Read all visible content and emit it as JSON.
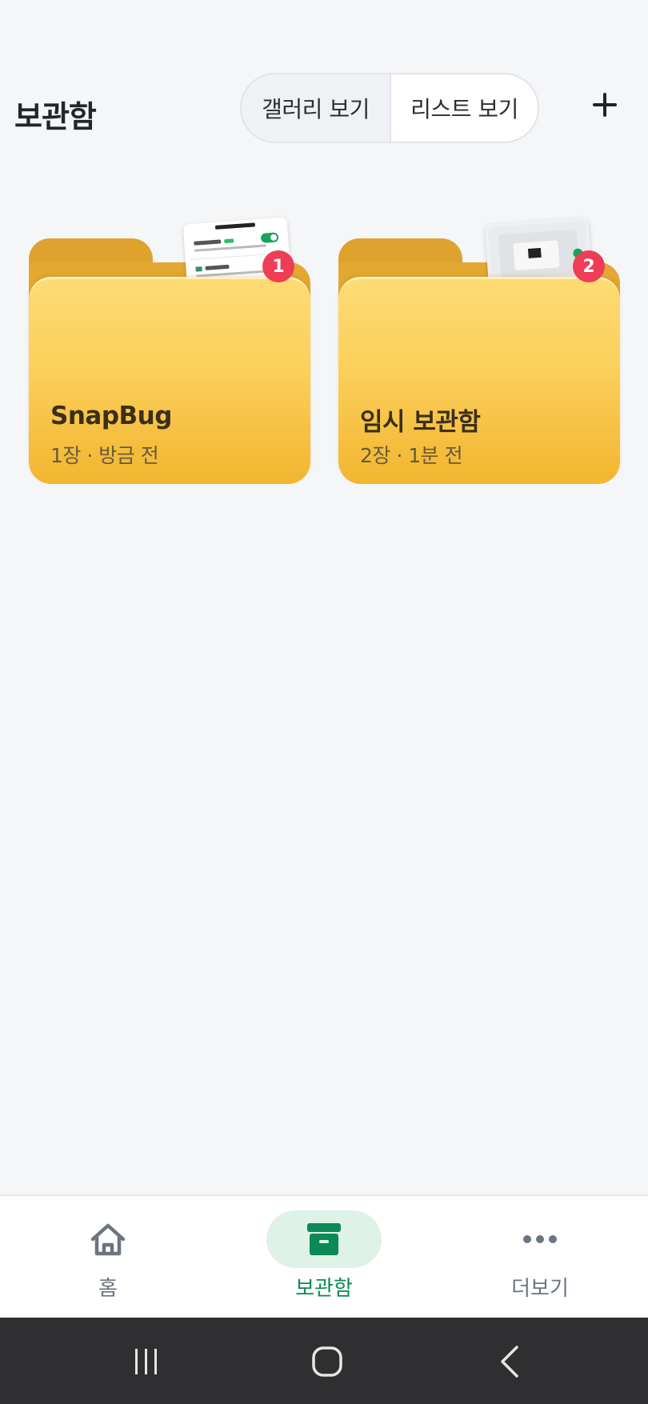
{
  "header": {
    "title": "보관함",
    "view_toggle": {
      "gallery_label": "갤러리 보기",
      "list_label": "리스트 보기",
      "selected": "리스트 보기"
    },
    "add_icon": "plus-icon"
  },
  "folders": [
    {
      "name": "SnapBug",
      "meta": "1장 · 방금 전",
      "badge": "1"
    },
    {
      "name": "임시 보관함",
      "meta": "2장 · 1분 전",
      "badge": "2"
    }
  ],
  "bottom_nav": {
    "items": [
      {
        "label": "홈",
        "icon": "home-icon",
        "active": false
      },
      {
        "label": "보관함",
        "icon": "archive-box-icon",
        "active": true
      },
      {
        "label": "더보기",
        "icon": "more-dots-icon",
        "active": false
      }
    ]
  },
  "system_bar": {
    "icons": [
      "recent-apps-icon",
      "home-circle-icon",
      "back-chevron-icon"
    ]
  },
  "colors": {
    "accent": "#0b8a57",
    "badge": "#ef3d55",
    "folder": "#fbcf5a"
  }
}
